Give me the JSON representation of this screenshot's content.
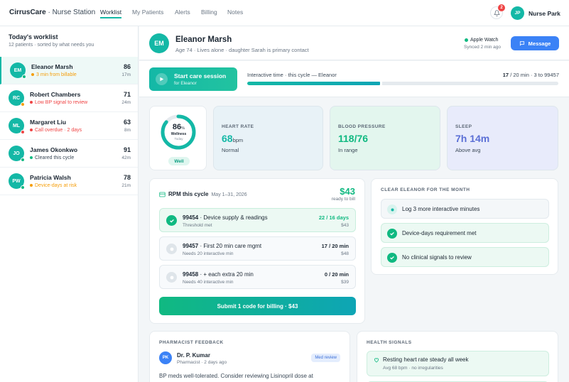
{
  "nav": {
    "brand": "CirrusCare",
    "brand_sub": " · Nurse Station",
    "tabs": [
      "Worklist",
      "My Patients",
      "Alerts",
      "Billing",
      "Notes"
    ],
    "notification_count": "2",
    "user_initials": "JP",
    "user_name": "Nurse Park"
  },
  "sidebar": {
    "title": "Today's worklist",
    "subtitle": "12 patients · sorted by what needs you",
    "patients": [
      {
        "initials": "EM",
        "name": "Eleanor Marsh",
        "status": "3 min from billable",
        "status_color": "#f59e0b",
        "dot_color": "#10b981",
        "score": "86",
        "time": "17m"
      },
      {
        "initials": "RC",
        "name": "Robert Chambers",
        "status": "Low BP signal to review",
        "status_color": "#ef4444",
        "dot_color": "#f59e0b",
        "score": "71",
        "time": "24m"
      },
      {
        "initials": "ML",
        "name": "Margaret Liu",
        "status": "Call overdue · 2 days",
        "status_color": "#ef4444",
        "dot_color": "#ef4444",
        "score": "63",
        "time": "8m"
      },
      {
        "initials": "JO",
        "name": "James Okonkwo",
        "status": "Cleared this cycle",
        "status_color": "#10b981",
        "dot_color": "#10b981",
        "score": "91",
        "time": "42m"
      },
      {
        "initials": "PW",
        "name": "Patricia Walsh",
        "status": "Device-days at risk",
        "status_color": "#f59e0b",
        "dot_color": "#10b981",
        "score": "78",
        "time": "21m"
      }
    ]
  },
  "patient": {
    "initials": "EM",
    "name": "Eleanor Marsh",
    "info": "Age 74 · Lives alone · daughter Sarah is primary contact",
    "device": "Apple Watch",
    "device_sync": "Synced 2 min ago",
    "message_label": "Message"
  },
  "session": {
    "start_label": "Start care session",
    "start_sub": "for Eleanor",
    "interactive_label": "Interactive time · this cycle — Eleanor",
    "minutes_current": "17",
    "minutes_rest": " / 20 min · 3 to 99457",
    "progress_fraction": 0.43
  },
  "metrics": {
    "wellness": {
      "value": "86",
      "suffix": "%",
      "label": "Wellness",
      "sub": "Today",
      "pill": "Well",
      "fraction": 0.86
    },
    "cards": [
      {
        "label": "HEART RATE",
        "value": "68",
        "unit": "bpm",
        "sub": "Normal",
        "color": "#14b8a6",
        "bg": "#e8f2f7"
      },
      {
        "label": "BLOOD PRESSURE",
        "value": "118/76",
        "unit": "",
        "sub": "In range",
        "color": "#10b981",
        "bg": "#e3f6ee"
      },
      {
        "label": "SLEEP",
        "value": "7h 14m",
        "unit": "",
        "sub": "Above avg",
        "color": "#5b6fd6",
        "bg": "#e8ebfb"
      }
    ]
  },
  "rpm": {
    "title": "RPM this cycle",
    "dates": "May 1–31, 2026",
    "amount": "$43",
    "amount_sub": "ready to bill",
    "codes": [
      {
        "code": "99454",
        "desc": " · Device supply & readings",
        "sub": "Threshold met",
        "progress": "22 / 16 days",
        "amount": "$43",
        "met": true
      },
      {
        "code": "99457",
        "desc": " · First 20 min care mgmt",
        "sub": "Needs 20 interactive min",
        "progress": "17 / 20 min",
        "amount": "$48",
        "met": false
      },
      {
        "code": "99458",
        "desc": " · + each extra 20 min",
        "sub": "Needs 40 interactive min",
        "progress": "0 / 20 min",
        "amount": "$39",
        "met": false
      }
    ],
    "submit_label": "Submit 1 code for billing · $43"
  },
  "clear": {
    "title": "CLEAR ELEANOR FOR THE MONTH",
    "tasks": [
      {
        "label": "Log 3 more interactive minutes",
        "done": false
      },
      {
        "label": "Device-days requirement met",
        "done": true
      },
      {
        "label": "No clinical signals to review",
        "done": true
      }
    ]
  },
  "pharmacist": {
    "title": "PHARMACIST FEEDBACK",
    "initials": "PK",
    "name": "Dr. P. Kumar",
    "sub": "Pharmacist · 2 days ago",
    "tag": "Med review",
    "text": "BP meds well-tolerated. Consider reviewing Lisinopril dose at"
  },
  "signals": {
    "title": "HEALTH SIGNALS",
    "items": [
      {
        "title": "Resting heart rate steady all week",
        "sub": "Avg 68 bpm · no irregularities"
      }
    ]
  }
}
